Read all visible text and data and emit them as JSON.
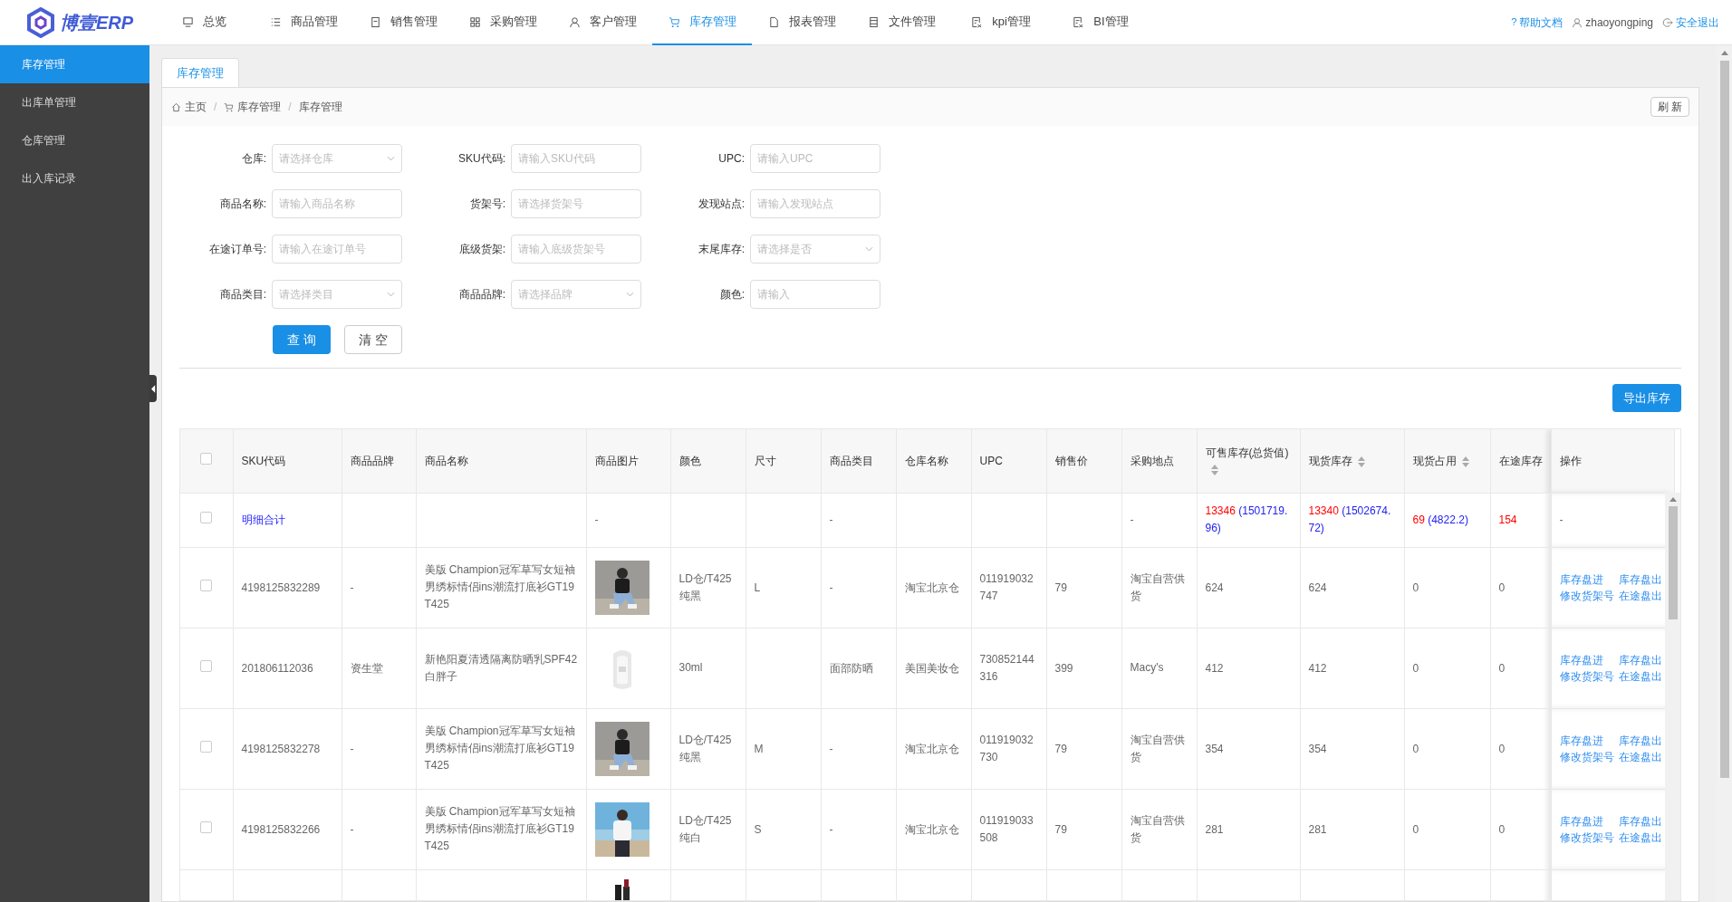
{
  "app": {
    "logo_text": "博壹ERP"
  },
  "nav": [
    {
      "label": "总览",
      "selected": false
    },
    {
      "label": "商品管理",
      "selected": false
    },
    {
      "label": "销售管理",
      "selected": false
    },
    {
      "label": "采购管理",
      "selected": false
    },
    {
      "label": "客户管理",
      "selected": false
    },
    {
      "label": "库存管理",
      "selected": true
    },
    {
      "label": "报表管理",
      "selected": false
    },
    {
      "label": "文件管理",
      "selected": false
    },
    {
      "label": "kpi管理",
      "selected": false
    },
    {
      "label": "BI管理",
      "selected": false
    }
  ],
  "header_right": {
    "help": "帮助文档",
    "help_mark": "?",
    "user": "zhaoyongping",
    "logout": "安全退出"
  },
  "sidebar": {
    "items": [
      {
        "label": "库存管理",
        "selected": true
      },
      {
        "label": "出库单管理",
        "selected": false
      },
      {
        "label": "仓库管理",
        "selected": false
      },
      {
        "label": "出入库记录",
        "selected": false
      }
    ]
  },
  "tabs": [
    {
      "label": "库存管理",
      "selected": true
    }
  ],
  "breadcrumb": [
    "主页",
    "库存管理",
    "库存管理"
  ],
  "breadcrumb_separator": "/",
  "refresh_button": "刷 新",
  "filters": [
    {
      "label": "仓库:",
      "placeholder": "请选择仓库",
      "kind": "select"
    },
    {
      "label": "SKU代码:",
      "placeholder": "请输入SKU代码",
      "kind": "input"
    },
    {
      "label": "UPC:",
      "placeholder": "请输入UPC",
      "kind": "input"
    },
    {
      "label": "商品名称:",
      "placeholder": "请输入商品名称",
      "kind": "input"
    },
    {
      "label": "货架号:",
      "placeholder": "请选择货架号",
      "kind": "input"
    },
    {
      "label": "发现站点:",
      "placeholder": "请输入发现站点",
      "kind": "input"
    },
    {
      "label": "在途订单号:",
      "placeholder": "请输入在途订单号",
      "kind": "input"
    },
    {
      "label": "底级货架:",
      "placeholder": "请输入底级货架号",
      "kind": "input"
    },
    {
      "label": "末尾库存:",
      "placeholder": "请选择是否",
      "kind": "select"
    },
    {
      "label": "商品类目:",
      "placeholder": "请选择类目",
      "kind": "select"
    },
    {
      "label": "商品品牌:",
      "placeholder": "请选择品牌",
      "kind": "select"
    },
    {
      "label": "颜色:",
      "placeholder": "请输入",
      "kind": "input"
    }
  ],
  "form_buttons": {
    "search": "查 询",
    "clear": "清 空"
  },
  "export_button": "导出库存",
  "table": {
    "header_checked": false,
    "columns": [
      {
        "label": "SKU代码",
        "sortable": false
      },
      {
        "label": "商品品牌",
        "sortable": false
      },
      {
        "label": "商品名称",
        "sortable": false
      },
      {
        "label": "商品图片",
        "sortable": false
      },
      {
        "label": "颜色",
        "sortable": false
      },
      {
        "label": "尺寸",
        "sortable": false
      },
      {
        "label": "商品类目",
        "sortable": false
      },
      {
        "label": "仓库名称",
        "sortable": false
      },
      {
        "label": "UPC",
        "sortable": false
      },
      {
        "label": "销售价",
        "sortable": false
      },
      {
        "label": "采购地点",
        "sortable": false
      },
      {
        "label": "可售库存(总货值)",
        "sortable": true
      },
      {
        "label": "现货库存",
        "sortable": true
      },
      {
        "label": "现货占用",
        "sortable": true
      },
      {
        "label": "在途库存",
        "sortable": false
      },
      {
        "label": "操作",
        "sortable": false
      }
    ],
    "summary": {
      "checked": false,
      "label": "明细合计",
      "image": "-",
      "category": "-",
      "purchase": "-",
      "available": {
        "qty": "13346",
        "value": "(1501719.96)"
      },
      "on_hand": {
        "qty": "13340",
        "value": "(1502674.72)"
      },
      "occupied": {
        "qty": "69",
        "value": "(4822.2)"
      },
      "in_transit": "154",
      "actions": "-"
    },
    "rows": [
      {
        "checked": false,
        "sku": "4198125832289",
        "brand": "-",
        "name": "美版 Champion冠军草写女短袖男绣标情侣ins潮流打底衫GT19 T425",
        "variant": "LD仓/T425 纯黑",
        "size": "L",
        "category": "-",
        "warehouse": "淘宝北京仓",
        "upc": "011919032747",
        "price": "79",
        "purchase": "淘宝自营供货",
        "available": "624",
        "on_hand": "624",
        "occupied": "0",
        "in_transit": "0",
        "actions": [
          "库存盘进",
          "库存盘出",
          "修改货架号",
          "在途盘出"
        ]
      },
      {
        "checked": false,
        "sku": "201806112036",
        "brand": "资生堂",
        "name": "新艳阳夏清透隔离防晒乳SPF42 白胖子",
        "variant": "30ml",
        "size": "",
        "category": "面部防晒",
        "warehouse": "美国美妆仓",
        "upc": "730852144316",
        "price": "399",
        "purchase": "Macy's",
        "available": "412",
        "on_hand": "412",
        "occupied": "0",
        "in_transit": "0",
        "actions": [
          "库存盘进",
          "库存盘出",
          "修改货架号",
          "在途盘出"
        ]
      },
      {
        "checked": false,
        "sku": "4198125832278",
        "brand": "-",
        "name": "美版 Champion冠军草写女短袖男绣标情侣ins潮流打底衫GT19 T425",
        "variant": "LD仓/T425 纯黑",
        "size": "M",
        "category": "-",
        "warehouse": "淘宝北京仓",
        "upc": "011919032730",
        "price": "79",
        "purchase": "淘宝自营供货",
        "available": "354",
        "on_hand": "354",
        "occupied": "0",
        "in_transit": "0",
        "actions": [
          "库存盘进",
          "库存盘出",
          "修改货架号",
          "在途盘出"
        ]
      },
      {
        "checked": false,
        "sku": "4198125832266",
        "brand": "-",
        "name": "美版 Champion冠军草写女短袖男绣标情侣ins潮流打底衫GT19 T425",
        "variant": "LD仓/T425 纯白",
        "size": "S",
        "category": "-",
        "warehouse": "淘宝北京仓",
        "upc": "011919033508",
        "price": "79",
        "purchase": "淘宝自营供货",
        "available": "281",
        "on_hand": "281",
        "occupied": "0",
        "in_transit": "0",
        "actions": [
          "库存盘进",
          "库存盘出",
          "修改货架号",
          "在途盘出"
        ]
      }
    ],
    "cut_row": true
  }
}
